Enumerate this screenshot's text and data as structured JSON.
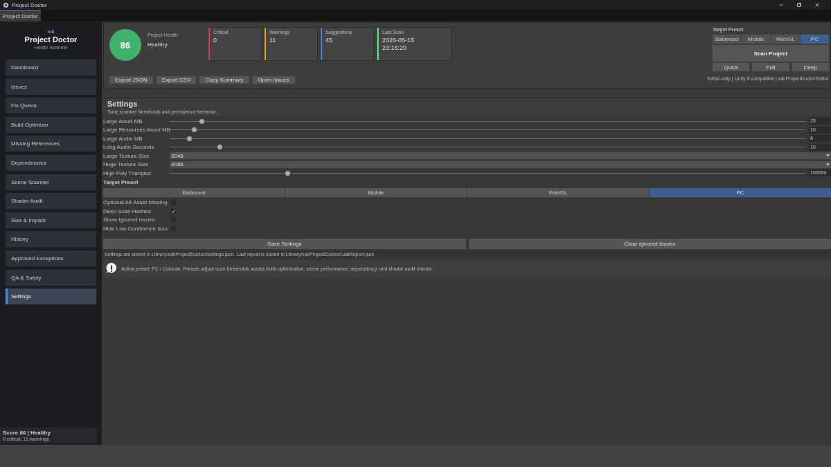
{
  "window": {
    "title": "Project Doctor"
  },
  "tabs": [
    {
      "label": "Project Doctor",
      "selected": true
    }
  ],
  "sidebar": {
    "vendor": "xal",
    "title": "Project Doctor",
    "subtitle": "Health Scanner",
    "items": [
      {
        "label": "Dashboard",
        "selected": false
      },
      {
        "label": "Issues",
        "selected": false
      },
      {
        "label": "Fix Queue",
        "selected": false
      },
      {
        "label": "Build Optimizer",
        "selected": false
      },
      {
        "label": "Missing References",
        "selected": false
      },
      {
        "label": "Dependencies",
        "selected": false
      },
      {
        "label": "Scene Scanner",
        "selected": false
      },
      {
        "label": "Shader Audit",
        "selected": false
      },
      {
        "label": "Size & Impact",
        "selected": false
      },
      {
        "label": "History",
        "selected": false
      },
      {
        "label": "Approved Exceptions",
        "selected": false
      },
      {
        "label": "QA & Safety",
        "selected": false
      },
      {
        "label": "Settings",
        "selected": true
      }
    ],
    "footer": {
      "score": "Score 86 | Healthy",
      "detail": "0 critical, 11 warnings"
    }
  },
  "health": {
    "score": "86",
    "label": "Project Health",
    "status": "Healthy"
  },
  "stats": [
    {
      "label": "Critical",
      "value": "0",
      "color": "#e0394a"
    },
    {
      "label": "Warnings",
      "value": "11",
      "color": "#f5a623"
    },
    {
      "label": "Suggestions",
      "value": "45",
      "color": "#3d8fe8"
    },
    {
      "label": "Last Scan",
      "value": "2026-05-15 23:16:20",
      "color": "#5fc77a"
    }
  ],
  "actions": [
    "Export JSON",
    "Export CSV",
    "Copy Summary",
    "Open Issues"
  ],
  "header_preset": {
    "label": "Target Preset",
    "options": [
      {
        "label": "Balanced",
        "selected": false
      },
      {
        "label": "Mobile",
        "selected": false
      },
      {
        "label": "WebGL",
        "selected": false
      },
      {
        "label": "PC",
        "selected": true
      }
    ],
    "scan": "Scan Project",
    "modes": [
      "Quick",
      "Full",
      "Deep"
    ],
    "info": "Editor-only | Unity 6 compatible | xal.ProjectDoctor.Editor"
  },
  "settings": {
    "title": "Settings",
    "subtitle": "Tune scanner thresholds and persistence behavior.",
    "fields": [
      {
        "kind": "slider",
        "label": "Large Asset MB",
        "level": 0.05,
        "value": "25"
      },
      {
        "kind": "slider",
        "label": "Large Resources Asset MB",
        "level": 0.038,
        "value": "10"
      },
      {
        "kind": "slider",
        "label": "Large Audio MB",
        "level": 0.03,
        "value": "8"
      },
      {
        "kind": "slider",
        "label": "Long Audio Seconds",
        "level": 0.078,
        "value": "10"
      },
      {
        "kind": "dropdown",
        "label": "Large Texture Size",
        "value": "2048"
      },
      {
        "kind": "dropdown",
        "label": "Huge Texture Size",
        "value": "4096"
      },
      {
        "kind": "slider",
        "label": "High Poly Triangles",
        "level": 0.185,
        "value": "100000"
      }
    ],
    "preset_label": "Target Preset",
    "presets": [
      {
        "label": "Balanced",
        "selected": false
      },
      {
        "label": "Mobile",
        "selected": false
      },
      {
        "label": "WebGL",
        "selected": false
      },
      {
        "label": "PC",
        "selected": true
      }
    ],
    "toggles": [
      {
        "label": "Optional All-Asset Missing",
        "checked": false
      },
      {
        "label": "Deep Scan Hashes",
        "checked": true
      },
      {
        "label": "Show Ignored Issues",
        "checked": false
      },
      {
        "label": "Hide Low Confidence Issu",
        "checked": false
      }
    ],
    "buttons": [
      "Save Settings",
      "Clear Ignored Issues"
    ],
    "storage_note": "Settings are stored in Library/xal/ProjectDoctor/Settings.json. Last report is stored in Library/xal/ProjectDoctor/LastReport.json.",
    "notice": "Active preset: PC / Console. Presets adjust scan thresholds across build optimization, scene performance, dependency, and shader audit checks."
  }
}
